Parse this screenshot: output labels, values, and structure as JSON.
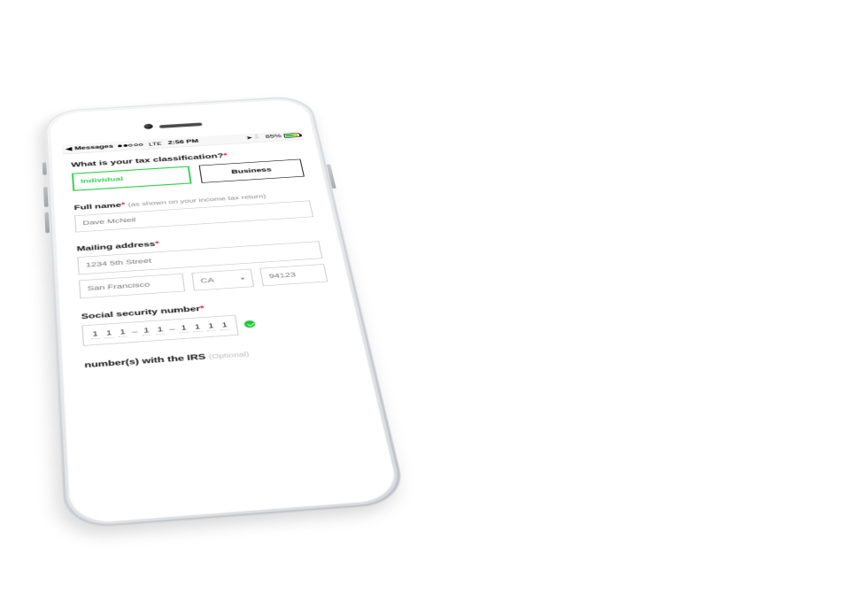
{
  "status": {
    "back_label": "Messages",
    "carrier": "LTE",
    "time": "2:56 PM",
    "battery_pct": "85%"
  },
  "classification": {
    "question": "What is your tax classification?",
    "options": {
      "individual": "Individual",
      "business": "Business"
    },
    "selected": "individual"
  },
  "full_name": {
    "label": "Full name",
    "hint": "(as shown on your income tax return)",
    "value": "Dave McNeil"
  },
  "mailing": {
    "label": "Mailing address",
    "street": "1234 5th Street",
    "city": "San Francisco",
    "state": "CA",
    "zip": "94123"
  },
  "ssn": {
    "label": "Social security number",
    "digits": [
      "1",
      "1",
      "1",
      "1",
      "1",
      "1",
      "1",
      "1",
      "1"
    ],
    "valid": true
  },
  "irs": {
    "label_prefix": "number(s) with the IRS",
    "optional": "(Optional)"
  }
}
